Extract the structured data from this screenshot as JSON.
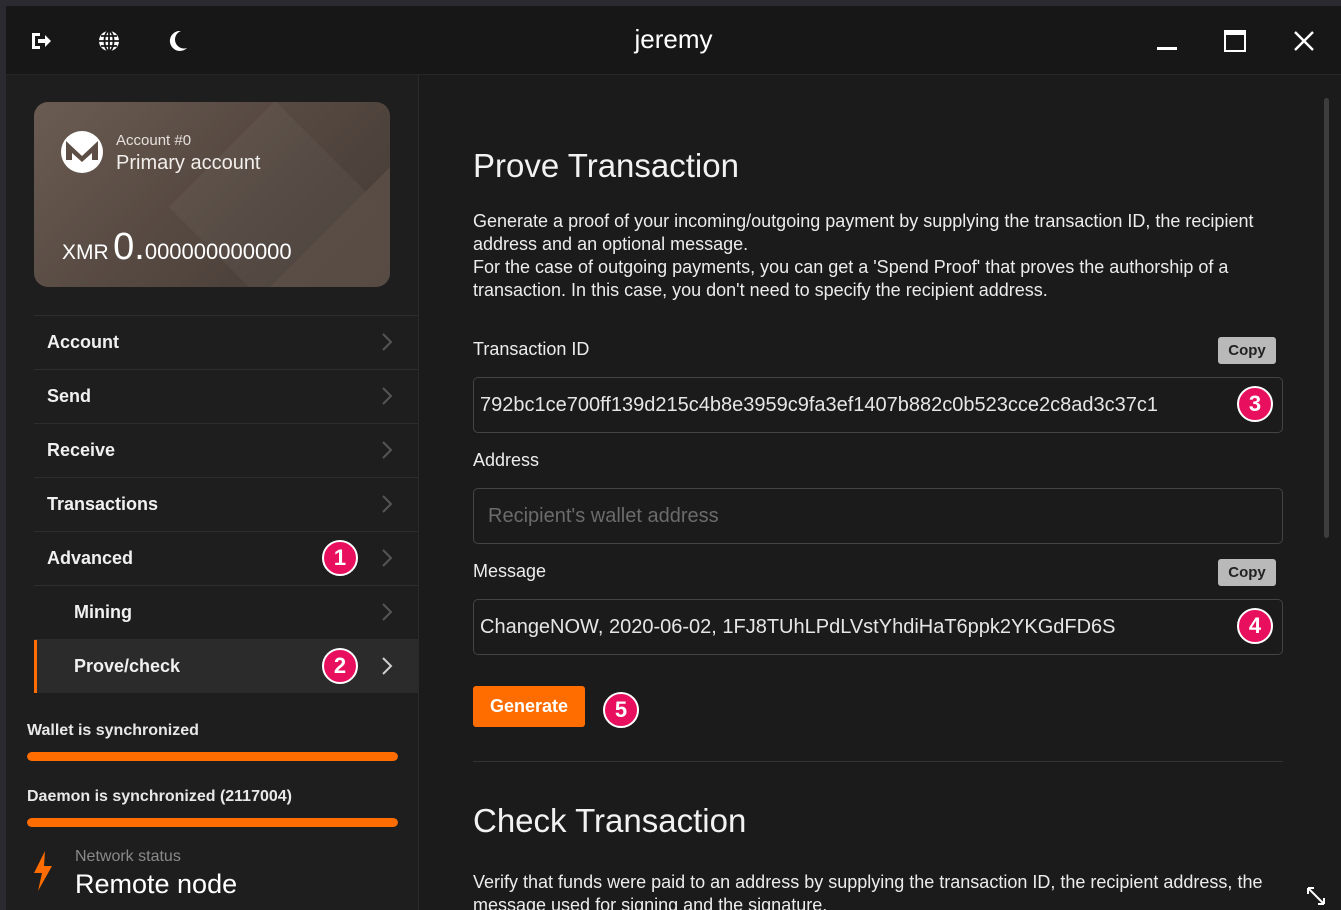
{
  "window": {
    "title": "jeremy",
    "toolbar_icons": [
      "logout-icon",
      "globe-icon",
      "moon-icon"
    ],
    "controls": [
      "minimize-icon",
      "maximize-icon",
      "close-icon"
    ]
  },
  "account_card": {
    "account_number": "Account #0",
    "account_name": "Primary account",
    "currency": "XMR",
    "balance_int": "0.",
    "balance_dec": "000000000000"
  },
  "sidebar": {
    "items": [
      {
        "label": "Account"
      },
      {
        "label": "Send"
      },
      {
        "label": "Receive"
      },
      {
        "label": "Transactions"
      },
      {
        "label": "Advanced"
      },
      {
        "label": "Mining"
      },
      {
        "label": "Prove/check"
      }
    ],
    "wallet_sync": {
      "label": "Wallet is synchronized",
      "progress": 1.0
    },
    "daemon_sync": {
      "label": "Daemon is synchronized (2117004)",
      "progress": 1.0
    },
    "network": {
      "label": "Network status",
      "value": "Remote node"
    }
  },
  "annotations": {
    "b1": "1",
    "b2": "2",
    "b3": "3",
    "b4": "4",
    "b5": "5"
  },
  "prove": {
    "title": "Prove Transaction",
    "desc1": "Generate a proof of your incoming/outgoing payment by supplying the transaction ID, the recipient address and an optional message.",
    "desc2": "For the case of outgoing payments, you can get a 'Spend Proof' that proves the authorship of a transaction. In this case, you don't need to specify the recipient address.",
    "txid_label": "Transaction ID",
    "txid_value": "792bc1ce700ff139d215c4b8e3959c9fa3ef1407b882c0b523cce2c8ad3c37c1",
    "copy_label": "Copy",
    "address_label": "Address",
    "address_placeholder": "Recipient's wallet address",
    "message_label": "Message",
    "message_value": "ChangeNOW, 2020-06-02, 1FJ8TUhLPdLVstYhdiHaT6ppk2YKGdFD6S",
    "generate_label": "Generate"
  },
  "check": {
    "title": "Check Transaction",
    "desc": "Verify that funds were paid to an address by supplying the transaction ID, the recipient address, the message used for signing and the signature."
  },
  "colors": {
    "accent": "#ff6c00",
    "badge": "#e8105e"
  }
}
